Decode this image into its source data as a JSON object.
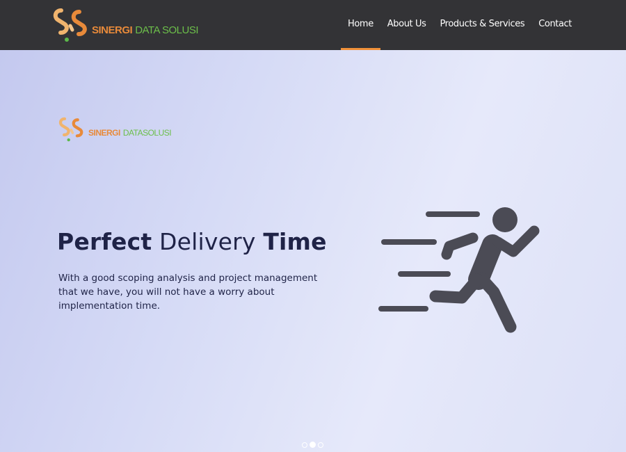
{
  "brand": {
    "name_part1": "SINERGI",
    "name_part2": "DATA",
    "name_part3": "SOLUSI",
    "colors": {
      "orange": "#e88a3a",
      "green": "#6cbf4a"
    }
  },
  "nav": {
    "items": [
      {
        "label": "Home",
        "active": true
      },
      {
        "label": "About Us",
        "active": false
      },
      {
        "label": "Products & Services",
        "active": false
      },
      {
        "label": "Contact",
        "active": false
      }
    ],
    "active_indicator_color": "#f0913a"
  },
  "hero": {
    "title_part1": "Perfect",
    "title_part2": "Delivery",
    "title_part3": "Time",
    "description_line1": "With a good scoping analysis and project management",
    "description_line2": "that we have, you will not have a worry about implementation time.",
    "illustration_icon": "running-person-icon"
  },
  "carousel": {
    "slide_count": 3,
    "active_slide": 2
  }
}
